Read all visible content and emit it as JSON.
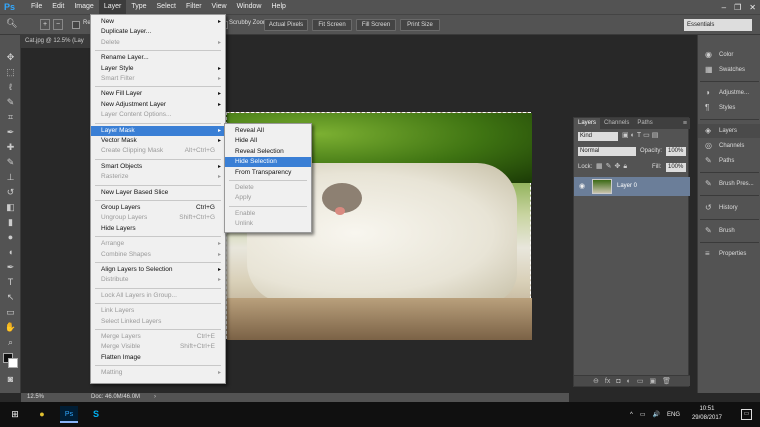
{
  "app": {
    "logo": "Ps"
  },
  "menubar": {
    "items": [
      "File",
      "Edit",
      "Image",
      "Layer",
      "Type",
      "Select",
      "Filter",
      "View",
      "Window",
      "Help"
    ],
    "active": "Layer",
    "window_controls": [
      "–",
      "❐",
      "✕"
    ]
  },
  "options_bar": {
    "partial_label": "Re",
    "scrubby_zoom": "Scrubby Zoom",
    "buttons": [
      "Actual Pixels",
      "Fit Screen",
      "Fill Screen",
      "Print Size"
    ],
    "workspace": "Essentials"
  },
  "document": {
    "tab_title": "Cat.jpg @ 12.5% (Lay",
    "zoom": "12.5%",
    "doc_info": "Doc: 46.0M/46.0M"
  },
  "layer_menu": {
    "items": [
      {
        "label": "New",
        "arrow": true
      },
      {
        "label": "Duplicate Layer..."
      },
      {
        "label": "Delete",
        "arrow": true,
        "disabled": true
      },
      {
        "sep": true
      },
      {
        "label": "Rename Layer..."
      },
      {
        "label": "Layer Style",
        "arrow": true
      },
      {
        "label": "Smart Filter",
        "arrow": true,
        "disabled": true
      },
      {
        "sep": true
      },
      {
        "label": "New Fill Layer",
        "arrow": true
      },
      {
        "label": "New Adjustment Layer",
        "arrow": true
      },
      {
        "label": "Layer Content Options...",
        "disabled": true
      },
      {
        "sep": true
      },
      {
        "label": "Layer Mask",
        "arrow": true,
        "highlight": true
      },
      {
        "label": "Vector Mask",
        "arrow": true
      },
      {
        "label": "Create Clipping Mask",
        "shortcut": "Alt+Ctrl+G",
        "disabled": true
      },
      {
        "sep": true
      },
      {
        "label": "Smart Objects",
        "arrow": true
      },
      {
        "label": "Rasterize",
        "arrow": true,
        "disabled": true
      },
      {
        "sep": true
      },
      {
        "label": "New Layer Based Slice"
      },
      {
        "sep": true
      },
      {
        "label": "Group Layers",
        "shortcut": "Ctrl+G"
      },
      {
        "label": "Ungroup Layers",
        "shortcut": "Shift+Ctrl+G",
        "disabled": true
      },
      {
        "label": "Hide Layers"
      },
      {
        "sep": true
      },
      {
        "label": "Arrange",
        "arrow": true,
        "disabled": true
      },
      {
        "label": "Combine Shapes",
        "arrow": true,
        "disabled": true
      },
      {
        "sep": true
      },
      {
        "label": "Align Layers to Selection",
        "arrow": true
      },
      {
        "label": "Distribute",
        "arrow": true,
        "disabled": true
      },
      {
        "sep": true
      },
      {
        "label": "Lock All Layers in Group...",
        "disabled": true
      },
      {
        "sep": true
      },
      {
        "label": "Link Layers",
        "disabled": true
      },
      {
        "label": "Select Linked Layers",
        "disabled": true
      },
      {
        "sep": true
      },
      {
        "label": "Merge Layers",
        "shortcut": "Ctrl+E",
        "disabled": true
      },
      {
        "label": "Merge Visible",
        "shortcut": "Shift+Ctrl+E",
        "disabled": true
      },
      {
        "label": "Flatten Image"
      },
      {
        "sep": true
      },
      {
        "label": "Matting",
        "arrow": true,
        "disabled": true
      }
    ]
  },
  "layer_mask_submenu": {
    "items": [
      {
        "label": "Reveal All"
      },
      {
        "label": "Hide All"
      },
      {
        "label": "Reveal Selection"
      },
      {
        "label": "Hide Selection",
        "highlight": true
      },
      {
        "label": "From Transparency"
      },
      {
        "sep": true
      },
      {
        "label": "Delete",
        "disabled": true
      },
      {
        "label": "Apply",
        "disabled": true
      },
      {
        "sep": true
      },
      {
        "label": "Enable",
        "disabled": true
      },
      {
        "label": "Unlink",
        "disabled": true
      }
    ]
  },
  "layers_panel": {
    "tabs": [
      "Layers",
      "Channels",
      "Paths"
    ],
    "kind": "Kind",
    "blend_mode": "Normal",
    "opacity_label": "Opacity:",
    "opacity": "100%",
    "lock_label": "Lock:",
    "fill_label": "Fill:",
    "fill": "100%",
    "layer_name": "Layer 0",
    "bottom_icons": [
      "⊖",
      "fx",
      "◘",
      "◐",
      "▭",
      "▣",
      "🗑"
    ]
  },
  "right_dock": {
    "items": [
      {
        "icon": "◉",
        "label": "Color"
      },
      {
        "icon": "▦",
        "label": "Swatches"
      },
      {
        "icon": "◑",
        "label": "Adjustme..."
      },
      {
        "icon": "¶",
        "label": "Styles"
      },
      {
        "icon": "◈",
        "label": "Layers"
      },
      {
        "icon": "◎",
        "label": "Channels"
      },
      {
        "icon": "✎",
        "label": "Paths"
      },
      {
        "icon": "✎",
        "label": "Brush Pres..."
      },
      {
        "icon": "↺",
        "label": "History"
      },
      {
        "icon": "✎",
        "label": "Brush"
      },
      {
        "icon": "≡",
        "label": "Properties"
      }
    ]
  },
  "taskbar": {
    "start": "⊞",
    "apps": [
      "●",
      "Ps",
      "S"
    ],
    "tray": [
      "^",
      "▭",
      "🔊",
      "ENG"
    ],
    "time": "10:51",
    "date": "29/08/2017",
    "notif": "▭"
  }
}
